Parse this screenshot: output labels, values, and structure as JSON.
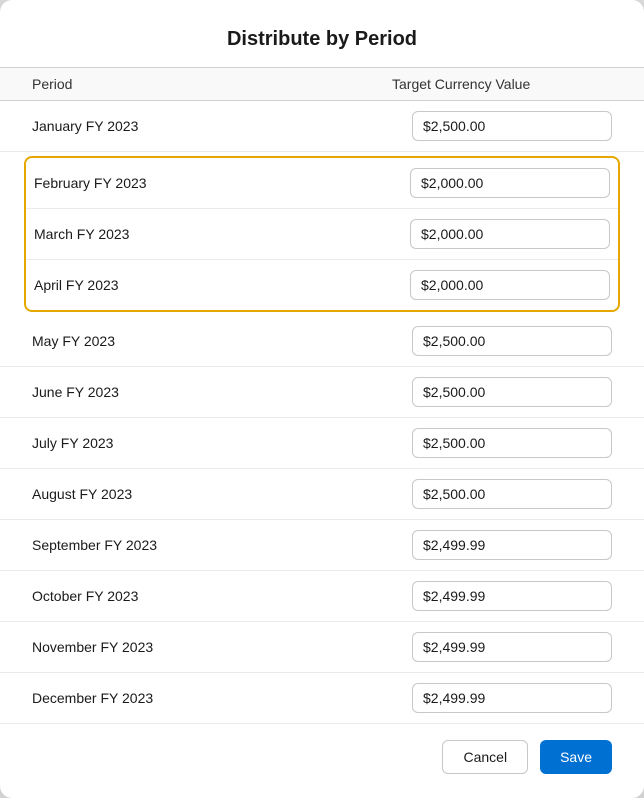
{
  "dialog": {
    "title": "Distribute by Period",
    "columns": {
      "period": "Period",
      "value": "Target Currency Value"
    },
    "rows": [
      {
        "id": "jan",
        "period": "January FY 2023",
        "value": "$2,500.00",
        "highlighted": false
      },
      {
        "id": "feb",
        "period": "February FY 2023",
        "value": "$2,000.00",
        "highlighted": true
      },
      {
        "id": "mar",
        "period": "March FY 2023",
        "value": "$2,000.00",
        "highlighted": true
      },
      {
        "id": "apr",
        "period": "April FY 2023",
        "value": "$2,000.00",
        "highlighted": true
      },
      {
        "id": "may",
        "period": "May FY 2023",
        "value": "$2,500.00",
        "highlighted": false
      },
      {
        "id": "jun",
        "period": "June FY 2023",
        "value": "$2,500.00",
        "highlighted": false
      },
      {
        "id": "jul",
        "period": "July FY 2023",
        "value": "$2,500.00",
        "highlighted": false
      },
      {
        "id": "aug",
        "period": "August FY 2023",
        "value": "$2,500.00",
        "highlighted": false
      },
      {
        "id": "sep",
        "period": "September FY 2023",
        "value": "$2,499.99",
        "highlighted": false
      },
      {
        "id": "oct",
        "period": "October FY 2023",
        "value": "$2,499.99",
        "highlighted": false
      },
      {
        "id": "nov",
        "period": "November FY 2023",
        "value": "$2,499.99",
        "highlighted": false
      },
      {
        "id": "dec",
        "period": "December FY 2023",
        "value": "$2,499.99",
        "highlighted": false
      }
    ],
    "buttons": {
      "cancel": "Cancel",
      "save": "Save"
    }
  }
}
